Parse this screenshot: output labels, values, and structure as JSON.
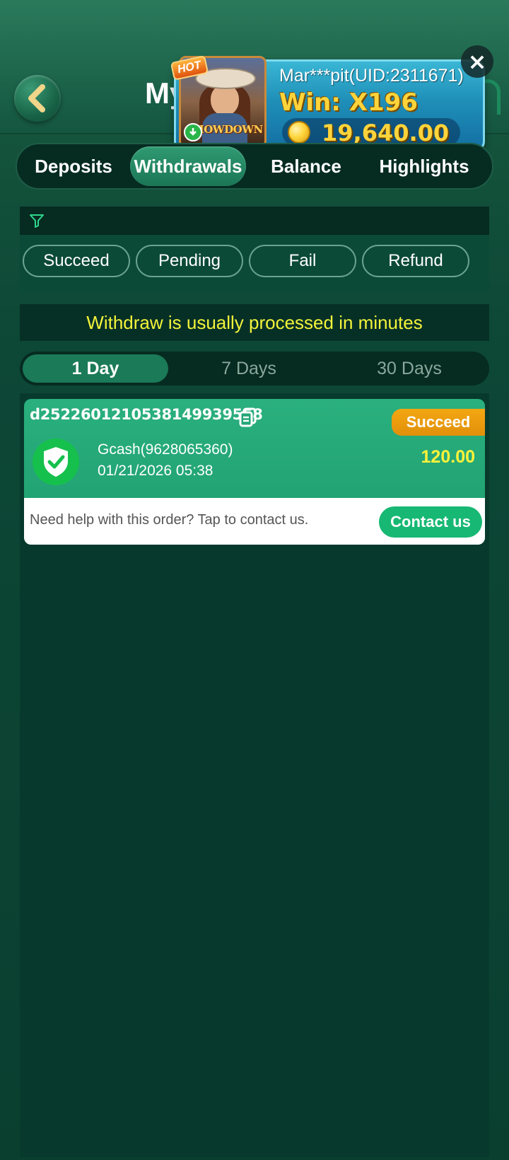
{
  "header": {
    "title": "My",
    "back_icon": "back-arrow-icon",
    "support_icon": "headset-icon"
  },
  "win_popup": {
    "hot_label": "HOT",
    "game_title": "SHOWDOWN",
    "user": "Mar***pit(UID:2311671)",
    "multiplier": "Win: X196",
    "amount": "19,640.00",
    "close_icon": "close-icon"
  },
  "tabs": [
    {
      "label": "Deposits",
      "active": false
    },
    {
      "label": "Withdrawals",
      "active": true
    },
    {
      "label": "Balance",
      "active": false
    },
    {
      "label": "Highlights",
      "active": false
    }
  ],
  "filter": {
    "icon": "filter-icon",
    "statuses": [
      "Succeed",
      "Pending",
      "Fail",
      "Refund"
    ]
  },
  "notice": "Withdraw is usually processed in minutes",
  "periods": [
    {
      "label": "1 Day",
      "active": true
    },
    {
      "label": "7 Days",
      "active": false
    },
    {
      "label": "30 Days",
      "active": false
    }
  ],
  "orders": [
    {
      "id": "d25226012105381499395​58",
      "status": "Succeed",
      "method": "Gcash(9628065360)",
      "datetime": "01/21/2026 05:38",
      "amount": "120.00",
      "help_text": "Need help with this order? Tap to contact us.",
      "contact_label": "Contact us"
    }
  ],
  "colors": {
    "accent": "#1b7a58",
    "notice_text": "#f3f33a",
    "amount": "#fff23a",
    "status_tag": "#f3a712",
    "contact_button": "#17b873"
  }
}
